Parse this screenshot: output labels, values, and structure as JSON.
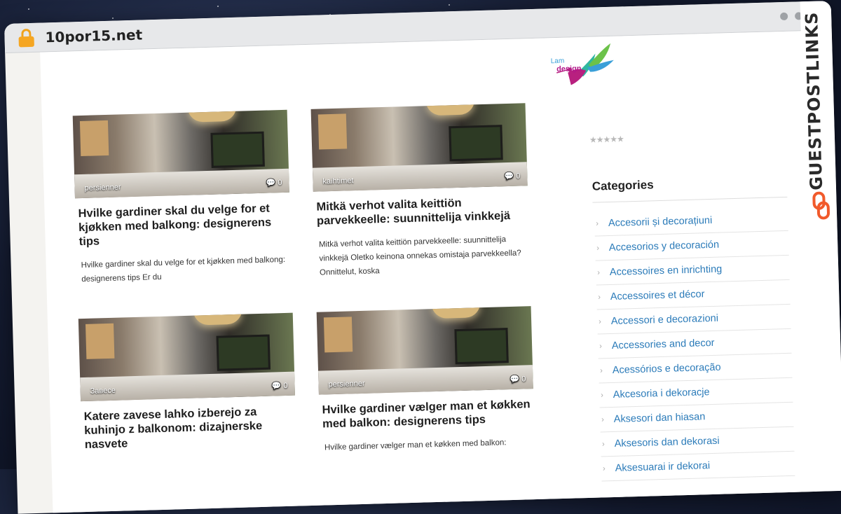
{
  "browser": {
    "url": "10por15.net"
  },
  "brand": {
    "logo_line1": "Lam",
    "logo_line2": "design",
    "side_banner": "GUESTPOSTLINKS"
  },
  "posts": [
    {
      "category": "persienner",
      "comments": "0",
      "title": "Hvilke gardiner skal du velge for et kjøkken med balkong: designerens tips",
      "excerpt": "Hvilke gardiner skal du velge for et kjøkken med balkong: designerens tips Er du"
    },
    {
      "category": "kaihtimet",
      "comments": "0",
      "title": "Mitkä verhot valita keittiön parvekkeelle: suunnittelija vinkkejä",
      "excerpt": "Mitkä verhot valita keittiön parvekkeelle: suunnittelija vinkkejä Oletko keinona onnekas omistaja parvekkeella? Onnittelut, koska"
    },
    {
      "category": "Завесе",
      "comments": "0",
      "title": "Katere zavese lahko izberejo za kuhinjo z balkonom: dizajnerske nasvete",
      "excerpt": ""
    },
    {
      "category": "persienner",
      "comments": "0",
      "title": "Hvilke gardiner vælger man et køkken med balkon: designerens tips",
      "excerpt": "Hvilke gardiner vælger man et køkken med balkon:"
    }
  ],
  "sidebar": {
    "rating_stars": "★★★★★",
    "categories_title": "Categories",
    "categories": [
      "Accesorii și decorațiuni",
      "Accesorios y decoración",
      "Accessoires en inrichting",
      "Accessoires et décor",
      "Accessori e decorazioni",
      "Accessories and decor",
      "Acessórios e decoração",
      "Akcesoria i dekoracje",
      "Aksesori dan hiasan",
      "Aksesoris dan dekorasi",
      "Aksesuarai ir dekorai"
    ]
  },
  "colors": {
    "link": "#2b7bb9",
    "lock": "#f5a623",
    "banner_accent": "#f15a2b"
  }
}
